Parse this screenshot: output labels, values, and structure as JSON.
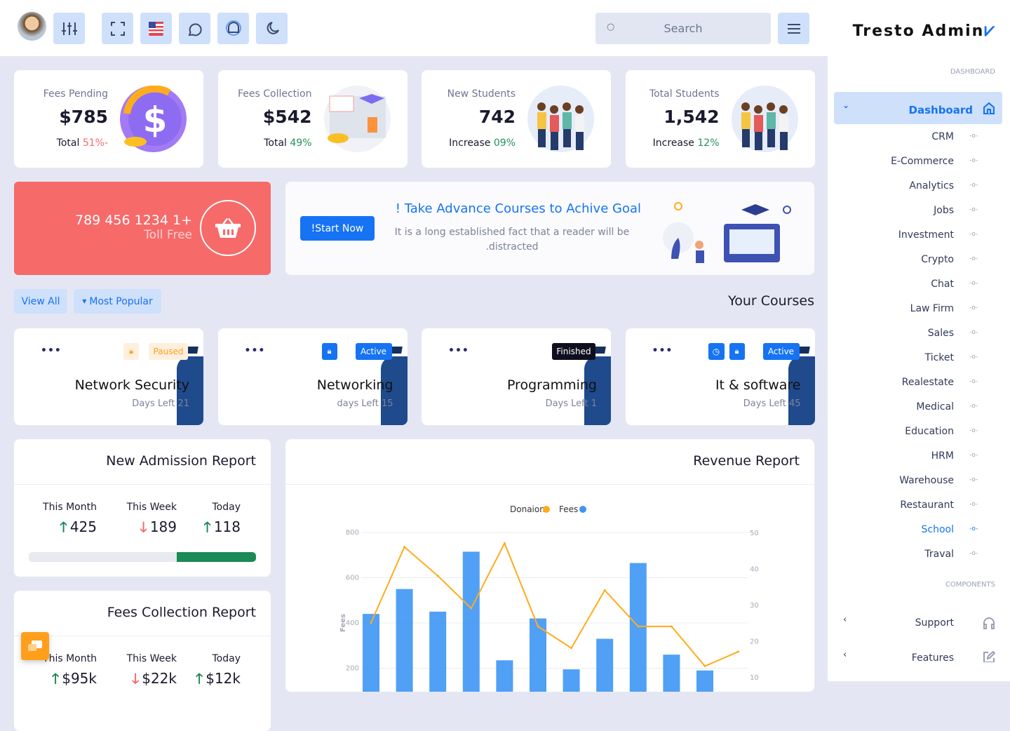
{
  "topbar": {
    "icons": [
      "avatar",
      "sliders-icon",
      "fullscreen-icon",
      "us-flag-icon",
      "chat-icon",
      "bell-icon",
      "moon-icon"
    ],
    "search_placeholder": "Search"
  },
  "sidebar": {
    "brand": "Tresto Admin",
    "section_dashboard": "DASHBOARD",
    "active": "Dashboard",
    "items": [
      "CRM",
      "E-Commerce",
      "Analytics",
      "Jobs",
      "Investment",
      "Crypto",
      "Chat",
      "Law Firm",
      "Sales",
      "Ticket",
      "Realestate",
      "Medical",
      "Education",
      "HRM",
      "Warehouse",
      "Restaurant",
      "School",
      "Traval"
    ],
    "highlighted": "School",
    "section_components": "COMPONENTS",
    "components": [
      "Support",
      "Features"
    ]
  },
  "stats": [
    {
      "label": "Fees Pending",
      "value": "$785",
      "sub_prefix": "Total",
      "sub_value": "51%-",
      "tone": "red"
    },
    {
      "label": "Fees Collection",
      "value": "$542",
      "sub_prefix": "Total",
      "sub_value": "49%",
      "tone": "green"
    },
    {
      "label": "New Students",
      "value": "742",
      "sub_prefix": "Increase",
      "sub_value": "09%",
      "tone": "green"
    },
    {
      "label": "Total Students",
      "value": "1,542",
      "sub_prefix": "Increase",
      "sub_value": "12%",
      "tone": "green"
    }
  ],
  "tollfree": {
    "phone": "789 456 1234 1+",
    "label": "Toll Free"
  },
  "banner": {
    "title": "! Take Advance Courses to Achive Goal",
    "text_line1": "It is a long established fact that a reader will be",
    "text_line2": ".distracted",
    "button": "!Start Now"
  },
  "courses_header": {
    "title": "Your Courses",
    "view_all": "View All",
    "filter": "Most Popular"
  },
  "courses": [
    {
      "title": "Network Security",
      "days": "Days Left 21",
      "status": "Paused"
    },
    {
      "title": "Networking",
      "days": "days Left 15",
      "status": "Active"
    },
    {
      "title": "Programming",
      "days": "Days Left 1",
      "status": "Finished"
    },
    {
      "title": "It & software",
      "days": "Days Left 45",
      "status": "Active"
    }
  ],
  "admission": {
    "title": "New Admission Report",
    "cols": [
      {
        "label": "This Month",
        "value": "425",
        "trend": "up"
      },
      {
        "label": "This Week",
        "value": "189",
        "trend": "down"
      },
      {
        "label": "Today",
        "value": "118",
        "trend": "up"
      }
    ],
    "progress_pct": 35
  },
  "fees_report": {
    "title": "Fees Collection Report",
    "cols": [
      {
        "label": "This Month",
        "value": "$95k",
        "trend": "up"
      },
      {
        "label": "This Week",
        "value": "$22k",
        "trend": "down"
      },
      {
        "label": "Today",
        "value": "$12k",
        "trend": "up"
      }
    ]
  },
  "revenue": {
    "title": "Revenue Report"
  },
  "chart_data": {
    "type": "bar+line",
    "legend_position": "top",
    "ylabel_left": "Fees",
    "left_ticks": [
      800,
      600,
      400,
      200
    ],
    "right_ticks": [
      50,
      40,
      30,
      20,
      10
    ],
    "ylim_left": [
      0,
      800
    ],
    "ylim_right": [
      0,
      50
    ],
    "grid": true,
    "series": [
      {
        "name": "Donaion",
        "type": "line",
        "axis": "right",
        "color": "#ffac1c",
        "values": [
          25,
          46,
          38,
          29,
          47,
          24,
          18,
          34,
          24,
          24,
          13,
          17
        ]
      },
      {
        "name": "Fees",
        "type": "bar",
        "axis": "left",
        "color": "#3d96f5",
        "values": [
          440,
          550,
          450,
          715,
          235,
          420,
          195,
          330,
          665,
          260,
          190,
          null
        ]
      }
    ]
  },
  "colors": {
    "primary": "#1673f3",
    "danger": "#f66a6a",
    "success": "#1f9457",
    "warning": "#ff9f1c"
  }
}
